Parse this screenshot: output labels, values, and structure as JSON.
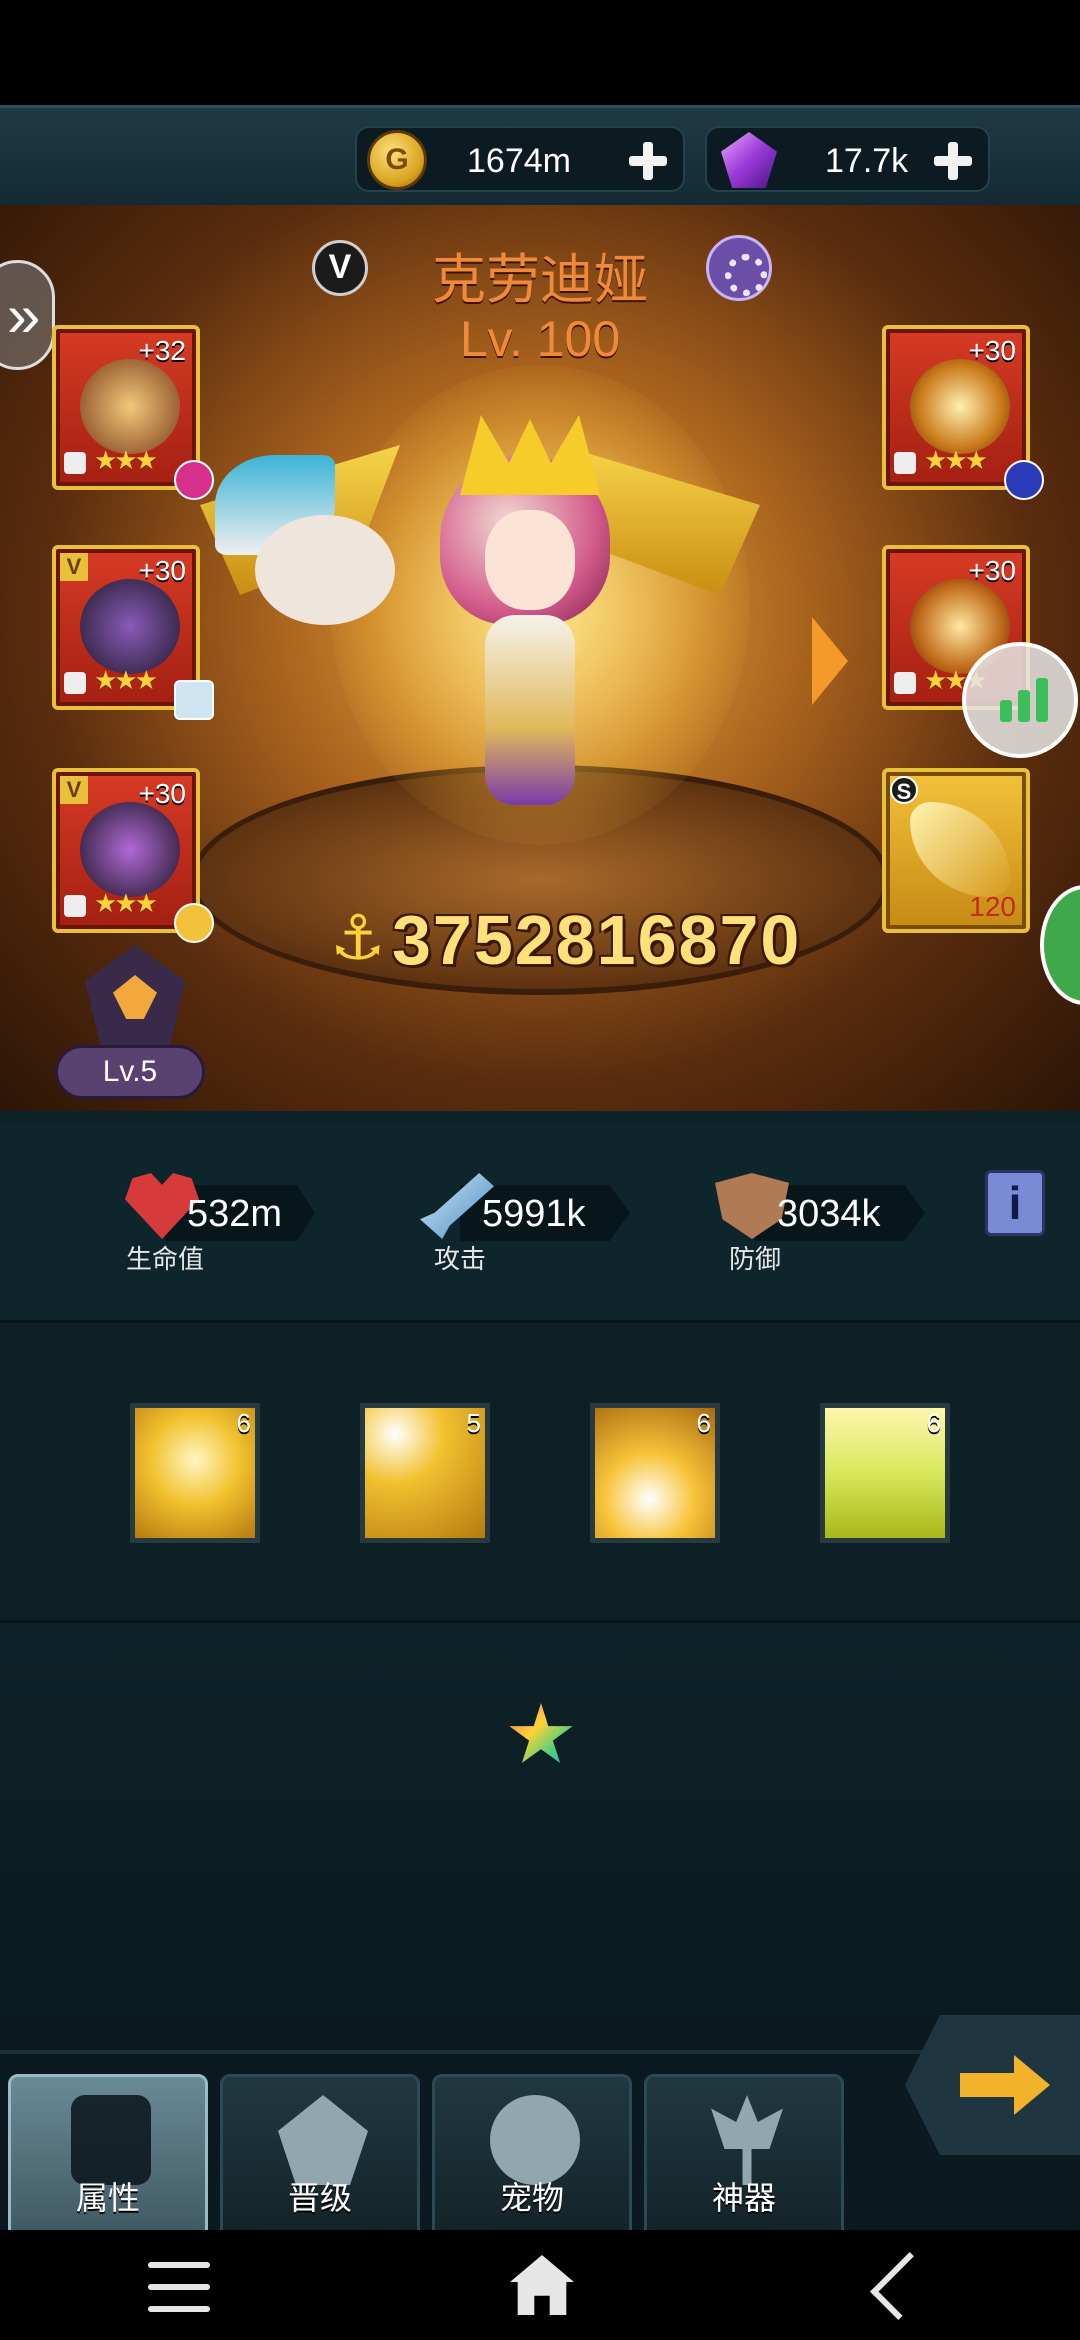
{
  "currencies": {
    "gold": {
      "icon": "gold-coin-icon",
      "letter": "G",
      "value": "1674m"
    },
    "gems": {
      "icon": "purple-gem-icon",
      "value": "17.7k"
    }
  },
  "hero": {
    "vip_letter": "V",
    "name": "克劳迪娅",
    "level": "Lv. 100",
    "power": "3752816870"
  },
  "equipment": [
    {
      "slot": "left-1",
      "plus": "+32",
      "stars": "★★★",
      "vip": ""
    },
    {
      "slot": "left-2",
      "plus": "+30",
      "stars": "★★★",
      "vip": "V"
    },
    {
      "slot": "left-3",
      "plus": "+30",
      "stars": "★★★",
      "vip": "V"
    },
    {
      "slot": "right-1",
      "plus": "+30",
      "stars": "★★★",
      "vip": ""
    },
    {
      "slot": "right-2",
      "plus": "+30",
      "stars": "★★★",
      "vip": ""
    },
    {
      "slot": "right-3",
      "grade": "S",
      "count": "120"
    }
  ],
  "pet_badge": {
    "level": "Lv.5"
  },
  "stats": {
    "hp": {
      "value": "532m",
      "label": "生命值",
      "icon": "heart-icon"
    },
    "attack": {
      "value": "5991k",
      "label": "攻击",
      "icon": "sword-icon"
    },
    "defense": {
      "value": "3034k",
      "label": "防御",
      "icon": "shield-icon"
    },
    "info_label": "i"
  },
  "skills": [
    {
      "level": "6"
    },
    {
      "level": "5"
    },
    {
      "level": "6"
    },
    {
      "level": "6"
    }
  ],
  "tabs": [
    {
      "label": "属性",
      "icon": "fist-icon",
      "active": true
    },
    {
      "label": "晋级",
      "icon": "promote-icon",
      "active": false
    },
    {
      "label": "宠物",
      "icon": "paw-icon",
      "active": false
    },
    {
      "label": "神器",
      "icon": "trident-icon",
      "active": false
    }
  ],
  "colors": {
    "accent_orange": "#f08a3a",
    "gold": "#ffe07a",
    "panel": "#0f252c"
  }
}
